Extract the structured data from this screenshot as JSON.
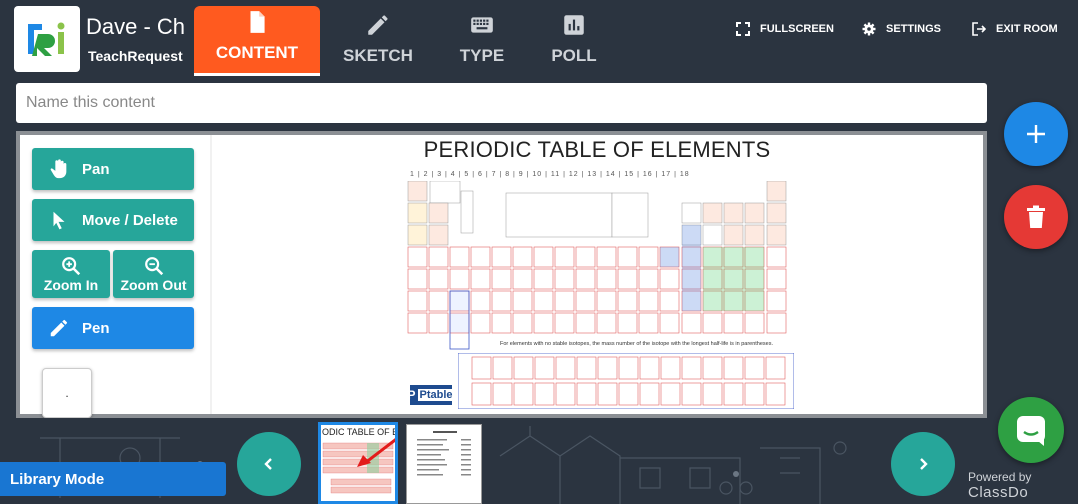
{
  "header": {
    "title": "Dave - Ch",
    "subtitle": "TeachRequest",
    "tabs": [
      {
        "label": "CONTENT",
        "icon": "file-icon",
        "active": true
      },
      {
        "label": "SKETCH",
        "icon": "pencil-icon",
        "active": false
      },
      {
        "label": "TYPE",
        "icon": "keyboard-icon",
        "active": false
      },
      {
        "label": "POLL",
        "icon": "bar-chart-icon",
        "active": false
      }
    ],
    "links": {
      "fullscreen": "FULLSCREEN",
      "settings": "SETTINGS",
      "exit": "EXIT ROOM"
    }
  },
  "content_name": {
    "placeholder": "Name this content",
    "value": ""
  },
  "tools": {
    "pan": "Pan",
    "move_delete": "Move / Delete",
    "zoom_in": "Zoom In",
    "zoom_out": "Zoom Out",
    "pen": "Pen",
    "swatch": "."
  },
  "document": {
    "title": "PERIODIC TABLE OF ELEMENTS",
    "group_numbers": "1 | 2 | 3 | 4 | 5 | 6 | 7 | 8 | 9 | 10 | 11 | 12 | 13 | 14 | 15 | 16 | 17 | 18",
    "note": "For elements with no stable isotopes, the mass number of the isotope with the longest half-life is in parentheses.",
    "brand": "Ptable"
  },
  "library": {
    "mode_label": "Library Mode",
    "thumb1_title": "ODIC TABLE OF ELEM"
  },
  "footer": {
    "powered": "Powered by",
    "brand": "ClassDo"
  },
  "colors": {
    "accent_orange": "#ff5a1f",
    "teal": "#26a69a",
    "blue": "#1e88e5",
    "red": "#e53935",
    "green": "#2ea043",
    "background": "#2b3440"
  }
}
